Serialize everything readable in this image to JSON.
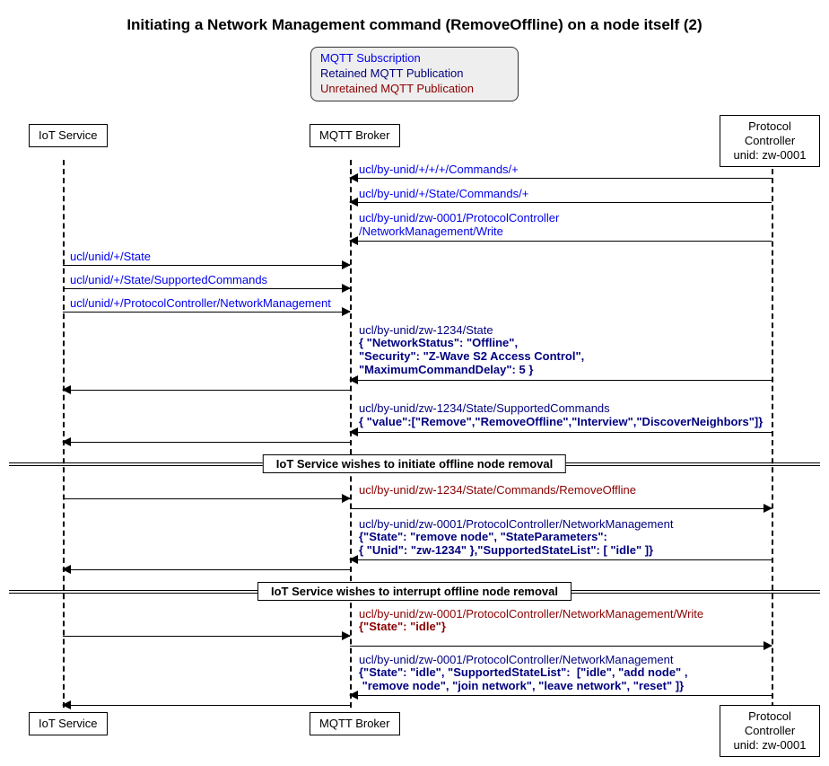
{
  "title": "Initiating a Network Management command (RemoveOffline) on a node itself (2)",
  "legend": {
    "subscription": "MQTT Subscription",
    "retained": "Retained MQTT Publication",
    "unretained": "Unretained MQTT Publication"
  },
  "actors": {
    "iot": "IoT Service",
    "broker": "MQTT Broker",
    "pc_line1": "Protocol Controller",
    "pc_line2": "unid: zw-0001"
  },
  "msgs": {
    "m1": "ucl/by-unid/+/+/+/Commands/+",
    "m2": "ucl/by-unid/+/State/Commands/+",
    "m3a": "ucl/by-unid/zw-0001/ProtocolController",
    "m3b": "/NetworkManagement/Write",
    "m4": "ucl/unid/+/State",
    "m5": "ucl/unid/+/State/SupportedCommands",
    "m6": "ucl/unid/+/ProtocolController/NetworkManagement",
    "m7_t": "ucl/by-unid/zw-1234/State",
    "m7_b": "{ \"NetworkStatus\": \"Offline\",\n\"Security\": \"Z-Wave S2 Access Control\",\n\"MaximumCommandDelay\": 5 }",
    "m8_t": "ucl/by-unid/zw-1234/State/SupportedCommands",
    "m8_b": "{ \"value\":[\"Remove\",\"RemoveOffline\",\"Interview\",\"DiscoverNeighbors\"]}",
    "m9": "ucl/by-unid/zw-1234/State/Commands/RemoveOffline",
    "m10_t": "ucl/by-unid/zw-0001/ProtocolController/NetworkManagement",
    "m10_b": "{\"State\": \"remove node\", \"StateParameters\":\n{ \"Unid\": \"zw-1234\" },\"SupportedStateList\": [ \"idle\" ]}",
    "m11_t": "ucl/by-unid/zw-0001/ProtocolController/NetworkManagement/Write",
    "m11_b": "{\"State\": \"idle\"}",
    "m12_t": "ucl/by-unid/zw-0001/ProtocolController/NetworkManagement",
    "m12_b": "{\"State\": \"idle\", \"SupportedStateList\":  [\"idle\", \"add node\" ,\n \"remove node\", \"join network\", \"leave network\", \"reset\" ]}"
  },
  "dividers": {
    "d1": "IoT Service wishes to initiate offline node removal",
    "d2": "IoT Service wishes to interrupt offline node removal"
  }
}
